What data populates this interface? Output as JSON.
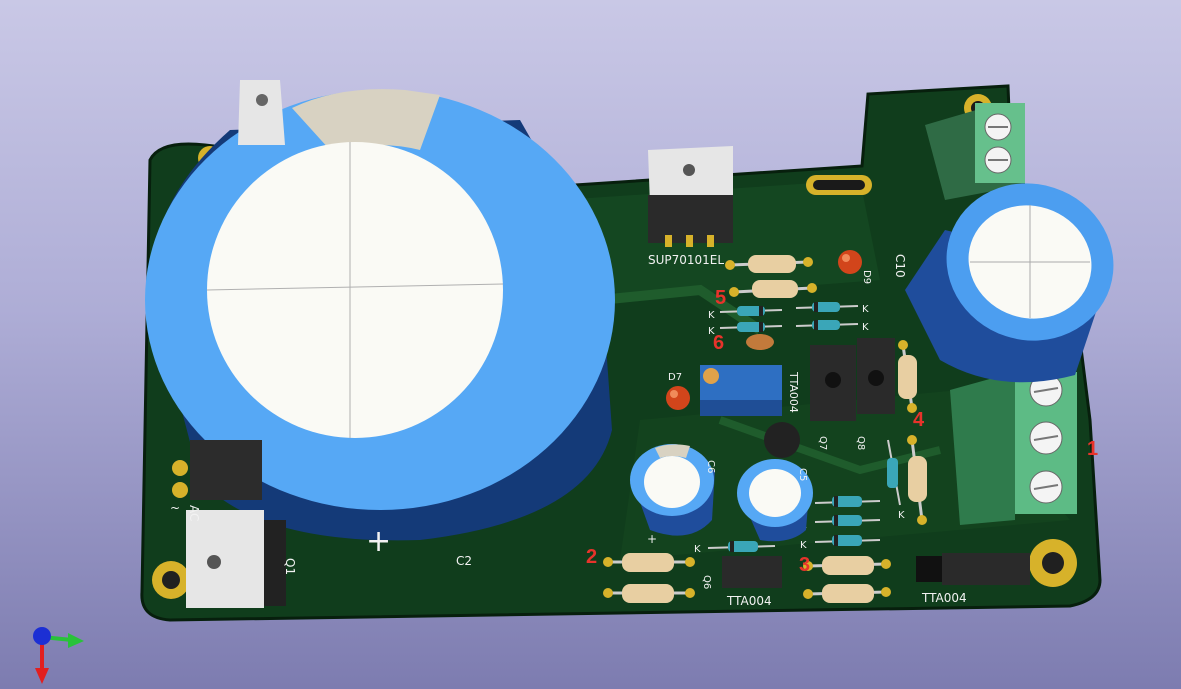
{
  "board": {
    "mosfet_label": "SUP70101EL",
    "transistor_labels": [
      "TTA004",
      "TTA004",
      "TTA004"
    ],
    "ref_designators": {
      "c2": "C2",
      "c10": "C10",
      "c6": "C6",
      "c5": "C5",
      "d9": "D9",
      "d7": "D7",
      "q1": "Q1",
      "q6": "Q6",
      "q7": "Q7",
      "q8": "Q8",
      "ac": "AC",
      "tilde": "~",
      "plus": "+"
    },
    "cathode_mark": "K",
    "markers": [
      "1",
      "2",
      "3",
      "4",
      "5",
      "6"
    ],
    "colors": {
      "pcb": "#0f3a1a",
      "pcb_edge": "#0a2a12",
      "silkscreen": "#f2f2f2",
      "capacitor_sleeve": "#56a8f5",
      "capacitor_top": "#fafaf5",
      "terminal_block": "#4fb87a",
      "pad_gold": "#d7b22a",
      "marker_red": "#e8332b"
    }
  },
  "viewer": {
    "axis_gizmo": [
      "x-axis",
      "y-axis",
      "z-axis"
    ]
  }
}
